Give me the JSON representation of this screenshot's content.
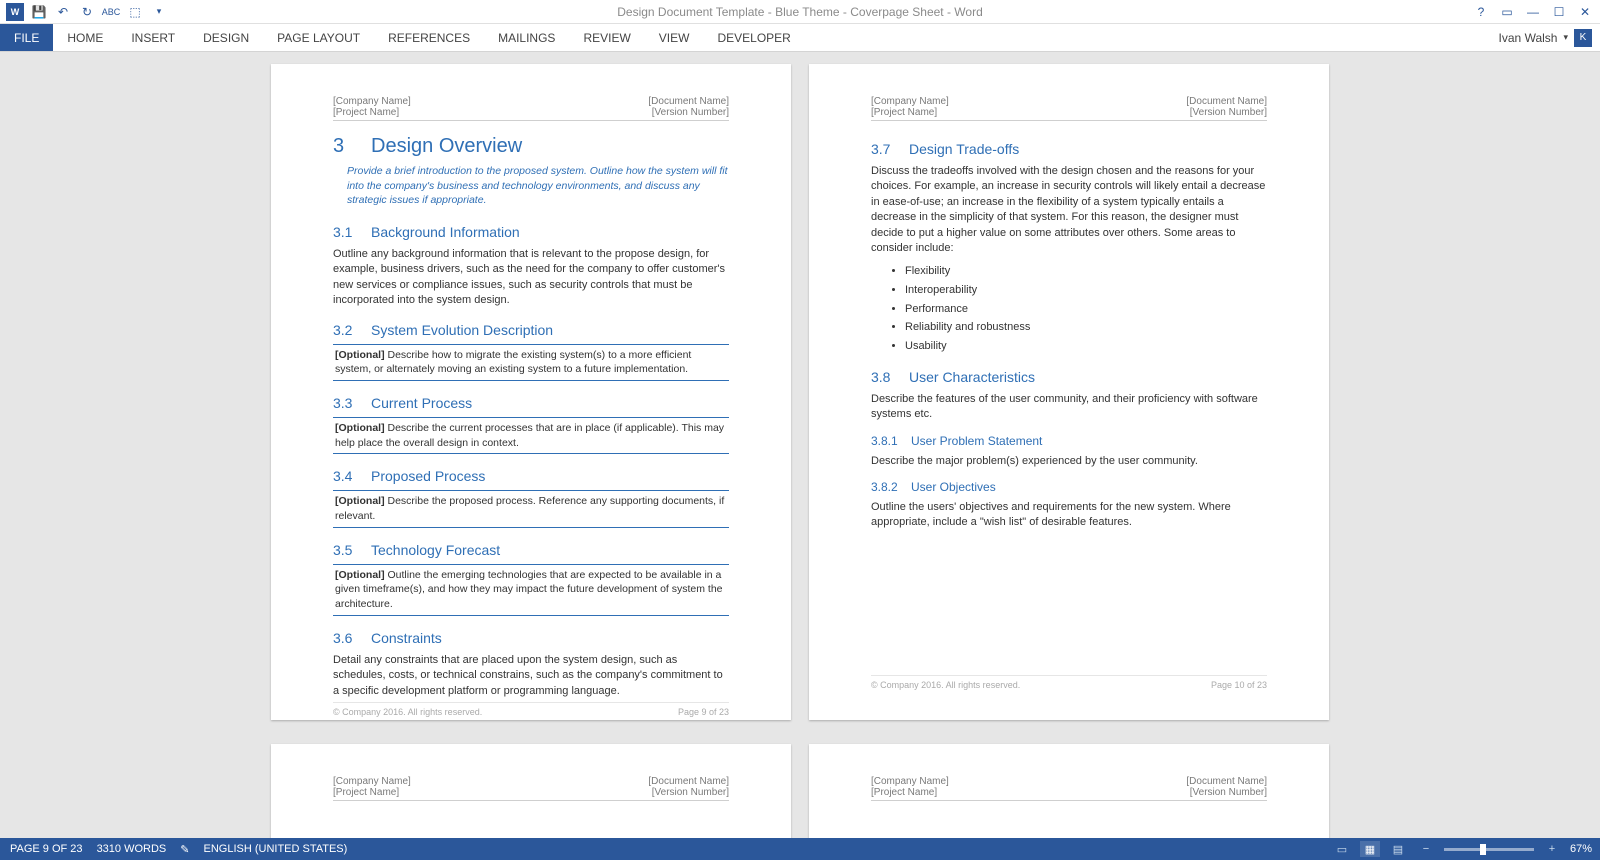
{
  "title": "Design Document Template - Blue Theme - Coverpage Sheet - Word",
  "user": {
    "name": "Ivan Walsh",
    "initial": "K"
  },
  "ribbon": [
    "FILE",
    "HOME",
    "INSERT",
    "DESIGN",
    "PAGE LAYOUT",
    "REFERENCES",
    "MAILINGS",
    "REVIEW",
    "VIEW",
    "DEVELOPER"
  ],
  "header": {
    "company": "[Company Name]",
    "project": "[Project Name]",
    "docname": "[Document Name]",
    "version": "[Version Number]"
  },
  "leftPage": {
    "h1num": "3",
    "h1": "Design Overview",
    "intro": "Provide a brief introduction to the proposed system. Outline how the system will fit into the company's business and technology environments, and discuss any strategic issues if appropriate.",
    "s31num": "3.1",
    "s31": "Background Information",
    "s31body": "Outline any background information that is relevant to the propose design, for example, business drivers, such as the need for the company to offer customer's new services or compliance issues, such as security controls that must be incorporated into the system design.",
    "s32num": "3.2",
    "s32": "System Evolution Description",
    "s32box_b": "[Optional]",
    "s32box": " Describe how to migrate the existing system(s) to a more efficient system, or alternately moving an existing system to a future implementation.",
    "s33num": "3.3",
    "s33": "Current Process",
    "s33box_b": "[Optional]",
    "s33box": " Describe the current processes that are in place (if applicable). This may help place the overall design in context.",
    "s34num": "3.4",
    "s34": "Proposed Process",
    "s34box_b": "[Optional]",
    "s34box": " Describe the proposed process. Reference any supporting documents, if relevant.",
    "s35num": "3.5",
    "s35": "Technology Forecast",
    "s35box_b": "[Optional]",
    "s35box": " Outline the emerging technologies that are expected to be available in a given timeframe(s), and how they may impact the future development of system the architecture.",
    "s36num": "3.6",
    "s36": "Constraints",
    "s36body": "Detail any constraints that are placed upon the system design, such as schedules, costs, or technical constrains, such as the company's commitment to a specific development platform or programming language.",
    "footer_l": "© Company 2016. All rights reserved.",
    "footer_r": "Page 9 of 23"
  },
  "rightPage": {
    "s37num": "3.7",
    "s37": "Design Trade-offs",
    "s37body": "Discuss the tradeoffs involved with the design chosen and the reasons for your choices. For example, an increase in security controls will likely entail a decrease in ease-of-use; an increase in the flexibility of a system typically entails a decrease in the simplicity of that system. For this reason, the designer must decide to put a higher value on some attributes over others. Some areas to consider include:",
    "bullets": [
      "Flexibility",
      "Interoperability",
      "Performance",
      "Reliability and robustness",
      "Usability"
    ],
    "s38num": "3.8",
    "s38": "User Characteristics",
    "s38body": "Describe the features of the user community, and their proficiency with software systems etc.",
    "s381num": "3.8.1",
    "s381": "User Problem Statement",
    "s381body": "Describe the major problem(s) experienced by the user community.",
    "s382num": "3.8.2",
    "s382": "User Objectives",
    "s382body": "Outline the users' objectives and requirements for the new system. Where appropriate, include a \"wish list\" of desirable features.",
    "footer_l": "© Company 2016. All rights reserved.",
    "footer_r": "Page 10 of 23"
  },
  "status": {
    "page": "PAGE 9 OF 23",
    "words": "3310 WORDS",
    "lang": "ENGLISH (UNITED STATES)",
    "zoom": "67%"
  }
}
